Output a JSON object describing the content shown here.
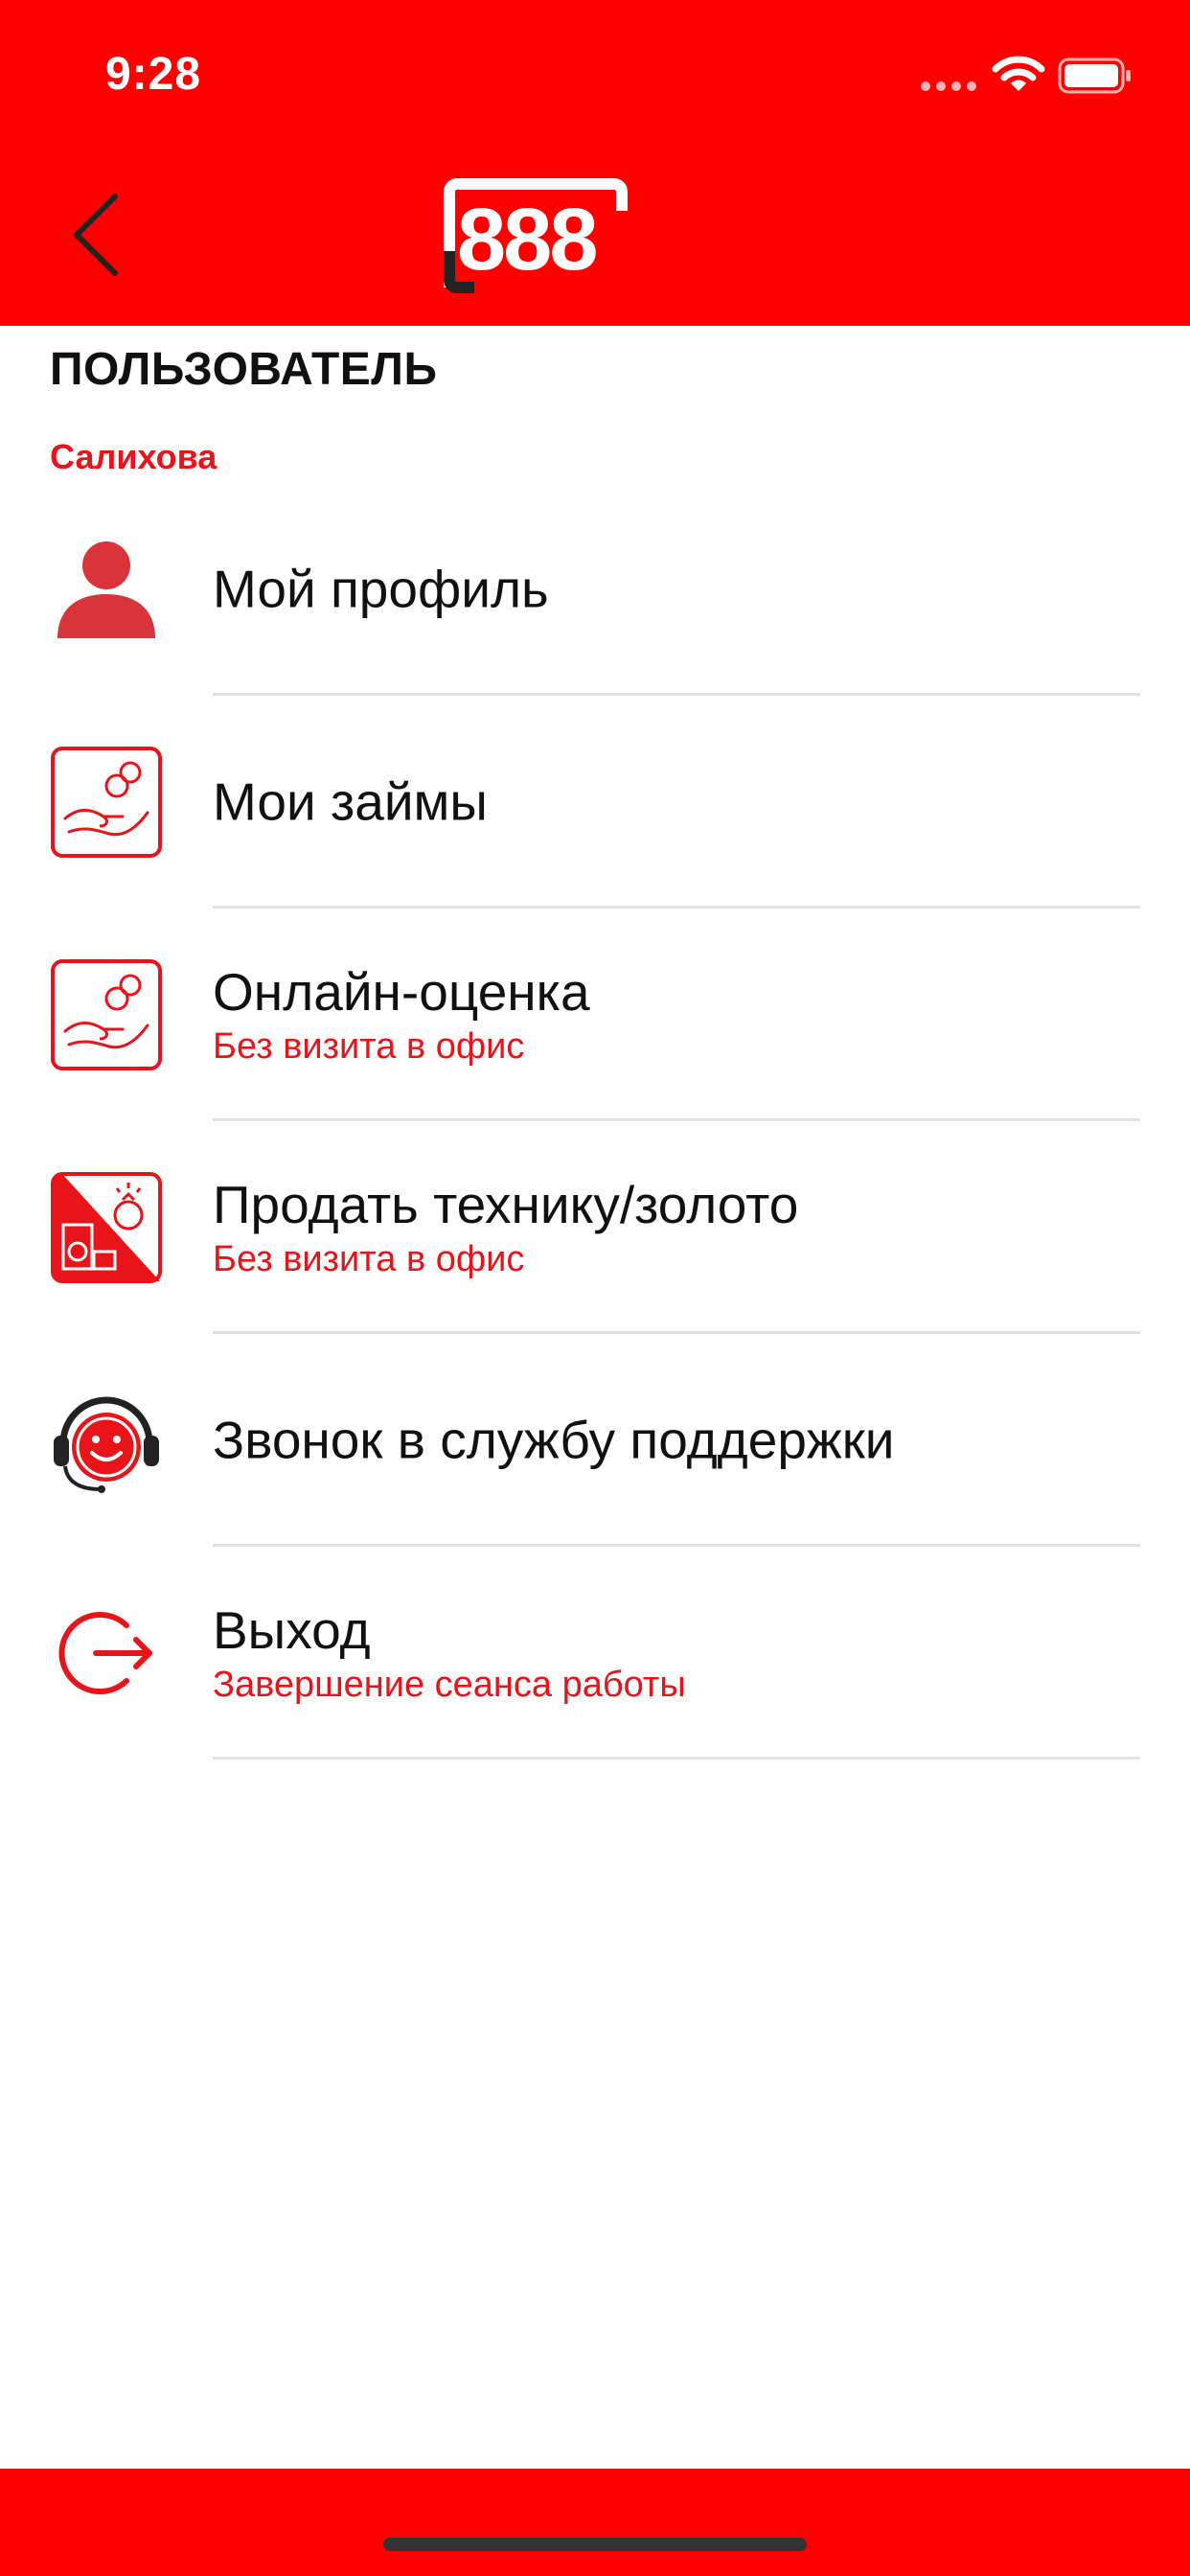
{
  "status_bar": {
    "time": "9:28"
  },
  "header": {
    "logo_text": "888",
    "brand_color": "#ff0000"
  },
  "section_title": "ПОЛЬЗОВАТЕЛЬ",
  "user_name": "Салихова",
  "accent_color": "#e8141a",
  "menu": [
    {
      "icon": "person-icon",
      "title": "Мой профиль",
      "subtitle": ""
    },
    {
      "icon": "hand-coins-icon",
      "title": "Мои займы",
      "subtitle": ""
    },
    {
      "icon": "hand-coins-icon",
      "title": "Онлайн-оценка",
      "subtitle": "Без визита в офис"
    },
    {
      "icon": "appliance-ring-icon",
      "title": "Продать технику/золото",
      "subtitle": "Без визита в офис"
    },
    {
      "icon": "headset-smiley-icon",
      "title": "Звонок в службу поддержки",
      "subtitle": ""
    },
    {
      "icon": "logout-icon",
      "title": "Выход",
      "subtitle": "Завершение сеанса работы"
    }
  ]
}
